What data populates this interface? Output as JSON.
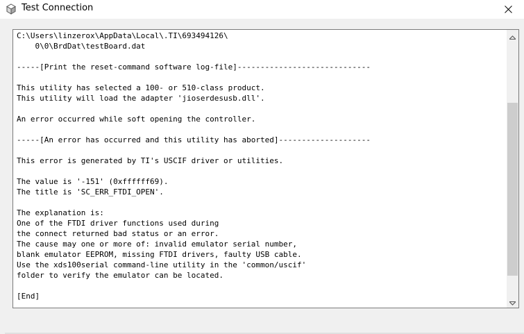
{
  "window": {
    "title": "Test Connection",
    "icon": "app-cube-icon",
    "close_icon": "close-icon"
  },
  "log": {
    "text": "C:\\Users\\linzerox\\AppData\\Local\\.TI\\693494126\\\n    0\\0\\BrdDat\\testBoard.dat\n\n-----[Print the reset-command software log-file]-----------------------------\n\nThis utility has selected a 100- or 510-class product.\nThis utility will load the adapter 'jioserdesusb.dll'.\n\nAn error occurred while soft opening the controller.\n\n-----[An error has occurred and this utility has aborted]--------------------\n\nThis error is generated by TI's USCIF driver or utilities.\n\nThe value is '-151' (0xffffff69).\nThe title is 'SC_ERR_FTDI_OPEN'.\n\nThe explanation is:\nOne of the FTDI driver functions used during\nthe connect returned bad status or an error.\nThe cause may one or more of: invalid emulator serial number,\nblank emulator EEPROM, missing FTDI drivers, faulty USB cable.\nUse the xds100serial command-line utility in the 'common/uscif'\nfolder to verify the emulator can be located.\n\n[End]"
  },
  "scrollbar": {
    "position": 0.75,
    "up_icon": "scroll-up-arrow-icon",
    "down_icon": "scroll-down-arrow-icon"
  },
  "colors": {
    "titlebar_bg": "#ffffff",
    "client_bg": "#f0f0f0",
    "text_box_border": "#7a7a7a",
    "scroll_thumb": "#cdcdcd"
  }
}
